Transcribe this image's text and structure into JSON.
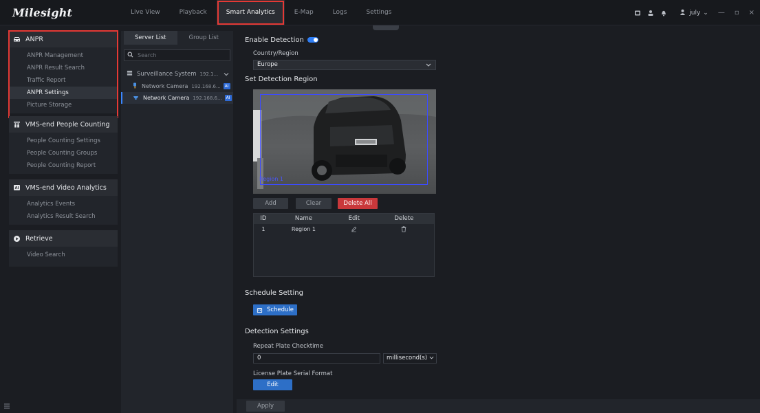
{
  "app": {
    "logo": "Milesight"
  },
  "nav": {
    "items": [
      "Live View",
      "Playback",
      "Smart Analytics",
      "E-Map",
      "Logs",
      "Settings"
    ]
  },
  "topbar": {
    "user": "july",
    "user_chevron": "⌄",
    "minimize": "—",
    "maximize": "▫",
    "close": "×"
  },
  "sidebar": {
    "groups": [
      {
        "title": "ANPR",
        "icon": "car-icon",
        "items": [
          "ANPR Management",
          "ANPR Result Search",
          "Traffic Report",
          "ANPR Settings",
          "Picture Storage"
        ]
      },
      {
        "title": "VMS-end People Counting",
        "icon": "people-icon",
        "items": [
          "People Counting Settings",
          "People Counting Groups",
          "People Counting Report"
        ]
      },
      {
        "title": "VMS-end Video Analytics",
        "icon": "ai-icon",
        "items": [
          "Analytics Events",
          "Analytics Result Search"
        ]
      },
      {
        "title": "Retrieve",
        "icon": "play-icon",
        "items": [
          "Video Search"
        ]
      }
    ],
    "active_item": "ANPR Settings"
  },
  "devices": {
    "tabs": [
      "Server List",
      "Group List"
    ],
    "search_placeholder": "Search",
    "root": {
      "name": "Surveillance System",
      "ip": "192.1..."
    },
    "cameras": [
      {
        "name": "Network Camera",
        "ip": "192.168.6...",
        "badge": "AI"
      },
      {
        "name": "Network Camera",
        "ip": "192.168.6...",
        "badge": "AI"
      }
    ]
  },
  "main": {
    "enable_detection": "Enable Detection",
    "country_label": "Country/Region",
    "country_value": "Europe",
    "set_region": "Set Detection Region",
    "region_label": "Region 1",
    "buttons": {
      "add": "Add",
      "clear": "Clear",
      "delete_all": "Delete All"
    },
    "table": {
      "headers": [
        "ID",
        "Name",
        "Edit",
        "Delete"
      ],
      "rows": [
        {
          "id": "1",
          "name": "Region 1"
        }
      ]
    },
    "schedule_title": "Schedule Setting",
    "schedule_button": "Schedule",
    "detection_title": "Detection Settings",
    "repeat_label": "Repeat Plate Checktime",
    "repeat_value": "0",
    "repeat_unit": "millisecond(s)",
    "serial_label": "License Plate Serial Format",
    "edit_button": "Edit",
    "apply_button": "Apply"
  },
  "colors": {
    "accent": "#2f7ef5",
    "danger": "#c9383b",
    "highlight": "#e53935",
    "region": "#3c4bff"
  }
}
